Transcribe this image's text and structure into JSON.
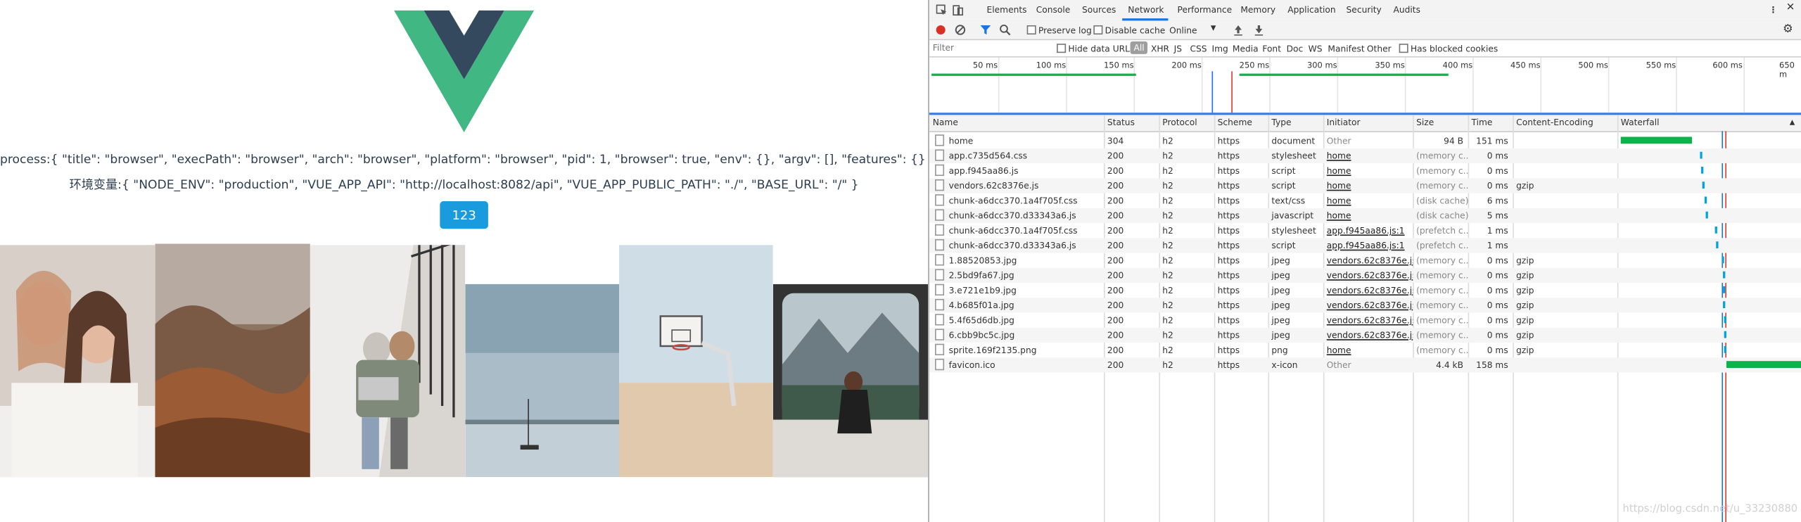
{
  "app": {
    "process_text": "process:{ \"title\": \"browser\", \"execPath\": \"browser\", \"arch\": \"browser\", \"platform\": \"browser\", \"pid\": 1, \"browser\": true, \"env\": {}, \"argv\": [], \"features\": {} }",
    "env_text": "环境变量:{ \"NODE_ENV\": \"production\", \"VUE_APP_API\": \"http://localhost:8082/api\", \"VUE_APP_PUBLIC_PATH\": \"./\", \"BASE_URL\": \"/\" }",
    "button_label": "123",
    "button_color": "#1a9bde",
    "logo_colors": {
      "outer": "#41b883",
      "inner": "#35495e"
    }
  },
  "devtools": {
    "tabs": [
      "Elements",
      "Console",
      "Sources",
      "Network",
      "Performance",
      "Memory",
      "Application",
      "Security",
      "Audits"
    ],
    "active_tab": "Network",
    "toolbar": {
      "preserve_log": "Preserve log",
      "disable_cache": "Disable cache",
      "throttle": "Online"
    },
    "filter": {
      "placeholder": "Filter",
      "hide_data_urls": "Hide data URLs",
      "types": [
        "All",
        "XHR",
        "JS",
        "CSS",
        "Img",
        "Media",
        "Font",
        "Doc",
        "WS",
        "Manifest",
        "Other"
      ],
      "active_type": "All",
      "has_blocked_cookies": "Has blocked cookies"
    },
    "timeline_ticks": [
      "50 ms",
      "100 ms",
      "150 ms",
      "200 ms",
      "250 ms",
      "300 ms",
      "350 ms",
      "400 ms",
      "450 ms",
      "500 ms",
      "550 ms",
      "600 ms",
      "650 m"
    ],
    "columns": [
      "Name",
      "Status",
      "Protocol",
      "Scheme",
      "Type",
      "Initiator",
      "Size",
      "Time",
      "Content-Encoding",
      "Waterfall"
    ],
    "rows": [
      {
        "name": "home",
        "status": "304",
        "protocol": "h2",
        "scheme": "https",
        "type": "document",
        "initiator": "Other",
        "size": "94 B",
        "time": "151 ms",
        "encoding": ""
      },
      {
        "name": "app.c735d564.css",
        "status": "200",
        "protocol": "h2",
        "scheme": "https",
        "type": "stylesheet",
        "initiator": "home",
        "size": "(memory c...",
        "time": "0 ms",
        "encoding": ""
      },
      {
        "name": "app.f945aa86.js",
        "status": "200",
        "protocol": "h2",
        "scheme": "https",
        "type": "script",
        "initiator": "home",
        "size": "(memory c...",
        "time": "0 ms",
        "encoding": ""
      },
      {
        "name": "vendors.62c8376e.js",
        "status": "200",
        "protocol": "h2",
        "scheme": "https",
        "type": "script",
        "initiator": "home",
        "size": "(memory c...",
        "time": "0 ms",
        "encoding": "gzip"
      },
      {
        "name": "chunk-a6dcc370.1a4f705f.css",
        "status": "200",
        "protocol": "h2",
        "scheme": "https",
        "type": "text/css",
        "initiator": "home",
        "size": "(disk cache)",
        "time": "6 ms",
        "encoding": ""
      },
      {
        "name": "chunk-a6dcc370.d33343a6.js",
        "status": "200",
        "protocol": "h2",
        "scheme": "https",
        "type": "javascript",
        "initiator": "home",
        "size": "(disk cache)",
        "time": "5 ms",
        "encoding": ""
      },
      {
        "name": "chunk-a6dcc370.1a4f705f.css",
        "status": "200",
        "protocol": "h2",
        "scheme": "https",
        "type": "stylesheet",
        "initiator": "app.f945aa86.js:1",
        "size": "(prefetch c...",
        "time": "1 ms",
        "encoding": ""
      },
      {
        "name": "chunk-a6dcc370.d33343a6.js",
        "status": "200",
        "protocol": "h2",
        "scheme": "https",
        "type": "script",
        "initiator": "app.f945aa86.js:1",
        "size": "(prefetch c...",
        "time": "1 ms",
        "encoding": ""
      },
      {
        "name": "1.88520853.jpg",
        "status": "200",
        "protocol": "h2",
        "scheme": "https",
        "type": "jpeg",
        "initiator": "vendors.62c8376e.js:7",
        "size": "(memory c...",
        "time": "0 ms",
        "encoding": "gzip"
      },
      {
        "name": "2.5bd9fa67.jpg",
        "status": "200",
        "protocol": "h2",
        "scheme": "https",
        "type": "jpeg",
        "initiator": "vendors.62c8376e.js:7",
        "size": "(memory c...",
        "time": "0 ms",
        "encoding": "gzip"
      },
      {
        "name": "3.e721e1b9.jpg",
        "status": "200",
        "protocol": "h2",
        "scheme": "https",
        "type": "jpeg",
        "initiator": "vendors.62c8376e.js:7",
        "size": "(memory c...",
        "time": "0 ms",
        "encoding": "gzip"
      },
      {
        "name": "4.b685f01a.jpg",
        "status": "200",
        "protocol": "h2",
        "scheme": "https",
        "type": "jpeg",
        "initiator": "vendors.62c8376e.js:7",
        "size": "(memory c...",
        "time": "0 ms",
        "encoding": "gzip"
      },
      {
        "name": "5.4f65d6db.jpg",
        "status": "200",
        "protocol": "h2",
        "scheme": "https",
        "type": "jpeg",
        "initiator": "vendors.62c8376e.js:7",
        "size": "(memory c...",
        "time": "0 ms",
        "encoding": "gzip"
      },
      {
        "name": "6.cbb9bc5c.jpg",
        "status": "200",
        "protocol": "h2",
        "scheme": "https",
        "type": "jpeg",
        "initiator": "vendors.62c8376e.js:7",
        "size": "(memory c...",
        "time": "0 ms",
        "encoding": "gzip"
      },
      {
        "name": "sprite.169f2135.png",
        "status": "200",
        "protocol": "h2",
        "scheme": "https",
        "type": "png",
        "initiator": "home",
        "size": "(memory c...",
        "time": "0 ms",
        "encoding": "gzip"
      },
      {
        "name": "favicon.ico",
        "status": "200",
        "protocol": "h2",
        "scheme": "https",
        "type": "x-icon",
        "initiator": "Other",
        "size": "4.4 kB",
        "time": "158 ms",
        "encoding": ""
      }
    ],
    "watermark": "https://blog.csdn.net/u_33230880"
  }
}
